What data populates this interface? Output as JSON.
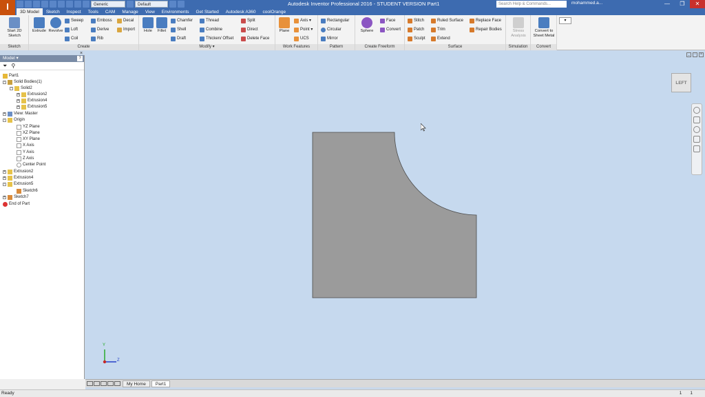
{
  "app": {
    "logo_letter": "I",
    "logo_sub": "PRO",
    "window_title": "Autodesk Inventor Professional 2016 - STUDENT VERSION    Part1",
    "help_placeholder": "Search Help & Commands...",
    "user_name": "mohammed.a...",
    "qat_material": "Generic",
    "qat_appearance": "Default",
    "win_min": "—",
    "win_max": "❐",
    "win_close": "✕"
  },
  "ribbon_tabs": [
    "3D Model",
    "Sketch",
    "Inspect",
    "Tools",
    "CAM",
    "Manage",
    "View",
    "Environments",
    "Get Started",
    "Autodesk A360",
    "coolOrange"
  ],
  "ribbon": {
    "sketch": {
      "label": "Sketch",
      "start_sketch": "Start 2D Sketch"
    },
    "create": {
      "label": "Create",
      "extrude": "Extrude",
      "revolve": "Revolve",
      "sweep": "Sweep",
      "loft": "Loft",
      "coil": "Coil",
      "emboss": "Emboss",
      "derive": "Derive",
      "rib": "Rib",
      "decal": "Decal",
      "import": "Import"
    },
    "modify": {
      "label": "Modify ▾",
      "hole": "Hole",
      "fillet": "Fillet",
      "chamfer": "Chamfer",
      "shell": "Shell",
      "draft": "Draft",
      "thread": "Thread",
      "combine": "Combine",
      "thicken": "Thicken/ Offset",
      "split": "Split",
      "direct": "Direct",
      "delete_face": "Delete Face"
    },
    "work_features": {
      "label": "Work Features",
      "plane": "Plane",
      "axis": "Axis ▾",
      "point": "Point ▾",
      "ucs": "UCS"
    },
    "pattern": {
      "label": "Pattern",
      "rectangular": "Rectangular",
      "circular": "Circular",
      "mirror": "Mirror"
    },
    "freeform": {
      "label": "Create Freeform",
      "sphere": "Sphere",
      "face": "Face",
      "convert": "Convert"
    },
    "surface": {
      "label": "Surface",
      "stitch": "Stitch",
      "patch": "Patch",
      "sculpt": "Sculpt",
      "ruled_surface": "Ruled Surface",
      "trim": "Trim",
      "extend": "Extend",
      "replace_face": "Replace Face",
      "repair_bodies": "Repair Bodies"
    },
    "simulation": {
      "label": "Simulation",
      "stress": "Stress Analysis"
    },
    "convert": {
      "label": "Convert",
      "sheet_metal": "Convert to Sheet Metal"
    }
  },
  "browser": {
    "close_glyph": "×",
    "header": "Model ▾",
    "help": "?",
    "tree": [
      {
        "label": "Part1",
        "icon": "part-icon"
      },
      {
        "label": "Solid Bodies(1)",
        "icon": "solid-bodies-icon"
      },
      {
        "label": "Solid2",
        "icon": "solid-icon"
      },
      {
        "label": "Extrusion2",
        "icon": "extrusion-icon"
      },
      {
        "label": "Extrusion4",
        "icon": "extrusion-icon"
      },
      {
        "label": "Extrusion5",
        "icon": "extrusion-icon"
      },
      {
        "label": "View: Master",
        "icon": "view-icon"
      },
      {
        "label": "Origin",
        "icon": "folder-icon"
      },
      {
        "label": "YZ Plane",
        "icon": "plane-icon"
      },
      {
        "label": "XZ Plane",
        "icon": "plane-icon"
      },
      {
        "label": "XY Plane",
        "icon": "plane-icon"
      },
      {
        "label": "X Axis",
        "icon": "axis-icon"
      },
      {
        "label": "Y Axis",
        "icon": "axis-icon"
      },
      {
        "label": "Z Axis",
        "icon": "axis-icon"
      },
      {
        "label": "Center Point",
        "icon": "point-icon"
      },
      {
        "label": "Extrusion2",
        "icon": "extrusion-icon"
      },
      {
        "label": "Extrusion4",
        "icon": "extrusion-icon"
      },
      {
        "label": "Extrusion5",
        "icon": "extrusion-icon"
      },
      {
        "label": "Sketch6",
        "icon": "sketch-icon"
      },
      {
        "label": "Sketch7",
        "icon": "sketch-icon"
      },
      {
        "label": "End of Part",
        "icon": "end-of-part-icon"
      }
    ]
  },
  "viewport": {
    "viewcube_label": "LEFT",
    "axis_y": "Y",
    "axis_z": "Z",
    "shape_color": "#9b9b9b",
    "background": "#c6d9ee"
  },
  "doc_tabs": {
    "home": "My Home",
    "part": "Part1"
  },
  "status": {
    "text": "Ready",
    "count1": "1",
    "count2": "1"
  }
}
